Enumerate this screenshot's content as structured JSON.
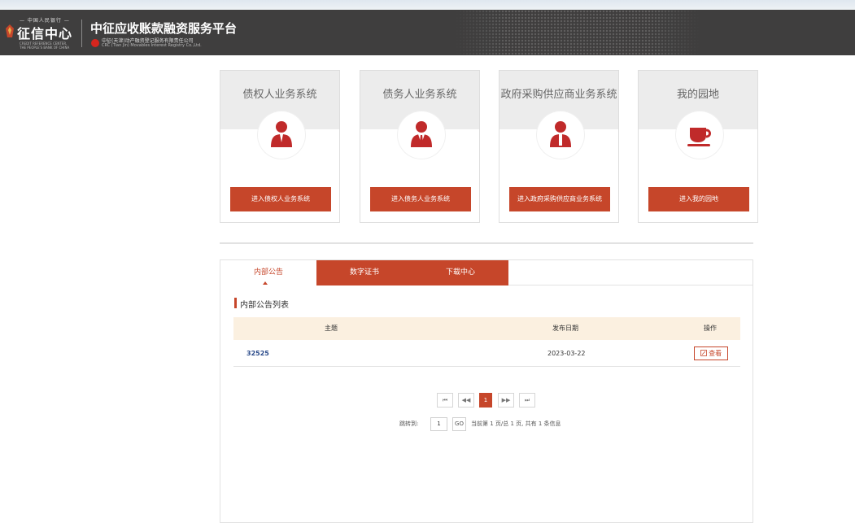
{
  "header": {
    "logo_top_small": "— 中国人民银行 —",
    "logo_text": "征信中心",
    "logo_en_1": "CREDIT REFERENCE CENTER,",
    "logo_en_2": "THE PEOPLE'S BANK OF CHINA",
    "platform_title": "中征应收账款融资服务平台",
    "crc_cn": "中征(天津)动产融资登记服务有限责任公司",
    "crc_en": "CRC (Tian Jin) Movables Interest Registry Co.,Ltd."
  },
  "cards": [
    {
      "title": "债权人业务系统",
      "button": "进入债权人业务系统"
    },
    {
      "title": "债务人业务系统",
      "button": "进入债务人业务系统"
    },
    {
      "title": "政府采购供应商业务系统",
      "button": "进入政府采购供应商业务系统"
    },
    {
      "title": "我的园地",
      "button": "进入我的园地"
    }
  ],
  "tabs": [
    {
      "label": "内部公告",
      "active": true
    },
    {
      "label": "数字证书",
      "active": false
    },
    {
      "label": "下载中心",
      "active": false
    }
  ],
  "notice_list": {
    "title": "内部公告列表",
    "columns": {
      "subject": "主题",
      "date": "发布日期",
      "action": "操作"
    },
    "rows": [
      {
        "subject": "32525",
        "date": "2023-03-22",
        "action": "查看"
      }
    ]
  },
  "pagination": {
    "first": "⏮",
    "prev": "◀◀",
    "current": "1",
    "next": "▶▶",
    "last": "⏭",
    "jump_label": "跳转到:",
    "jump_value": "1",
    "go": "GO",
    "summary": "当前第 1 页/总 1 页, 共有 1 条信息"
  },
  "colors": {
    "accent": "#c6462a",
    "header_bg": "#3f3e3e",
    "table_head_bg": "#fbf0e0"
  },
  "icons": [
    "creditor-person-icon",
    "debtor-person-icon",
    "supplier-person-icon",
    "coffee-cup-icon",
    "edit-icon"
  ]
}
